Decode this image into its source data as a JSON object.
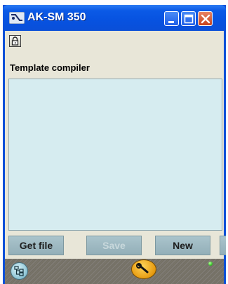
{
  "window": {
    "title": "AK-SM 350",
    "controls": {
      "minimize": "minimize",
      "maximize": "maximize",
      "close": "close"
    }
  },
  "toolbar": {
    "lock_icon": "padlock-icon"
  },
  "section": {
    "title": "Template compiler"
  },
  "editor": {
    "content": ""
  },
  "buttons": {
    "get_file": "Get file",
    "save": "Save",
    "new": "New"
  },
  "status_bar": {
    "tree_icon": "tree-structure-icon",
    "tool_icon": "wrench-icon",
    "indicator_color": "#2bbf20"
  },
  "colors": {
    "titlebar": "#0752e0",
    "client_bg": "#e8e6d8",
    "editor_bg": "#d6ecf0",
    "button_bg": "#a3bec6"
  }
}
